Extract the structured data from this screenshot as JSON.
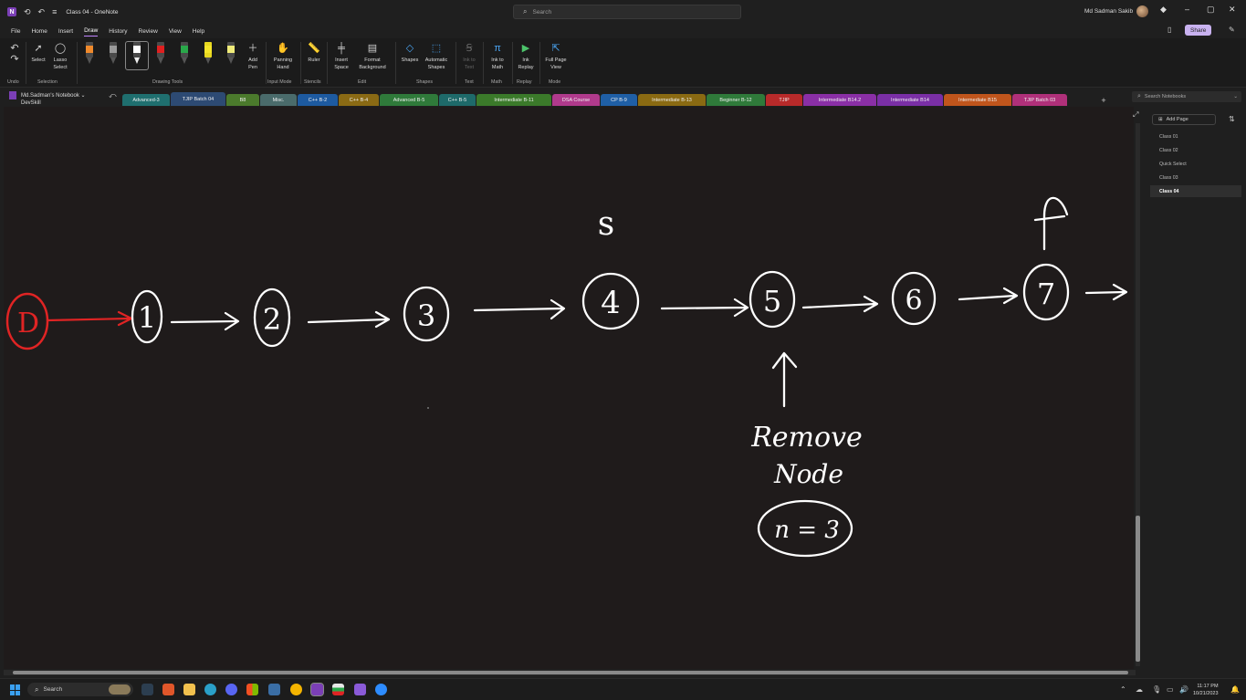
{
  "window": {
    "title": "Class 04  -  OneNote",
    "search_placeholder": "Search",
    "user_name": "Md Sadman Sakib",
    "share_label": "Share"
  },
  "menu": [
    "File",
    "Home",
    "Insert",
    "Draw",
    "History",
    "Review",
    "View",
    "Help"
  ],
  "ribbon": {
    "undo": "Undo",
    "select": "Select",
    "lasso": "Lasso Select",
    "selection_group": "Selection",
    "drawing_tools_group": "Drawing Tools",
    "add_pen": "Add Pen",
    "panning_hand": "Panning Hand",
    "input_mode_group": "Input Mode",
    "ruler": "Ruler",
    "stencils_group": "Stencils",
    "insert_space": "Insert Space",
    "format_background": "Format Background",
    "edit_group": "Edit",
    "shapes": "Shapes",
    "automatic_shapes": "Automatic Shapes",
    "shapes_group": "Shapes",
    "ink_to_text": "Ink to Text",
    "text_group": "Text",
    "ink_to_math": "Ink to Math",
    "math_group": "Math",
    "ink_replay": "Ink Replay",
    "replay_group": "Replay",
    "full_page_view": "Full Page View",
    "mode_group": "Mode"
  },
  "notebook": {
    "name": "Md.Sadman's Notebook",
    "subtitle": "DevSkill"
  },
  "sections": [
    {
      "label": "Advanced-3",
      "color": "#1f6f6f"
    },
    {
      "label": "TJIP Batch 04",
      "color": "#2d4a73"
    },
    {
      "label": "B8",
      "color": "#4b7a2c"
    },
    {
      "label": "Misc.",
      "color": "#4a6b6b"
    },
    {
      "label": "C++ B-2",
      "color": "#1d5aa0"
    },
    {
      "label": "C++ B-4",
      "color": "#8a6a14"
    },
    {
      "label": "Advanced B-5",
      "color": "#2f7a3a"
    },
    {
      "label": "C++ B-5",
      "color": "#1e6a6a"
    },
    {
      "label": "Intermediate B-11",
      "color": "#3b7a2a"
    },
    {
      "label": "DSA Course",
      "color": "#b03a8c"
    },
    {
      "label": "CP B-9",
      "color": "#1f5fa6"
    },
    {
      "label": "Intermediate B-13",
      "color": "#8a6a12"
    },
    {
      "label": "Beginner B-12",
      "color": "#2f7a3a"
    },
    {
      "label": "TJIP",
      "color": "#b82a2a"
    },
    {
      "label": "Intermediate B14.2",
      "color": "#8a2fa6"
    },
    {
      "label": "Intermediate B14",
      "color": "#7a2fa6"
    },
    {
      "label": "Intermediate B15",
      "color": "#c0551c"
    },
    {
      "label": "TJIP Batch 03",
      "color": "#b0307a"
    }
  ],
  "search_notebooks": "Search Notebooks",
  "pages": {
    "add_page": "Add Page",
    "items": [
      "Class 01",
      "Class 02",
      "Quick Select",
      "Class 03",
      "Class 04"
    ]
  },
  "ink": {
    "dummy_node": "D",
    "nodes": [
      "1",
      "2",
      "3",
      "4",
      "5",
      "6",
      "7"
    ],
    "slow_pointer": "s",
    "fast_pointer": "f",
    "remove_line1": "Remove",
    "remove_line2": "Node",
    "n_label": "n = 3"
  },
  "taskbar": {
    "search": "Search",
    "time": "11:17 PM",
    "date": "10/21/2023"
  }
}
